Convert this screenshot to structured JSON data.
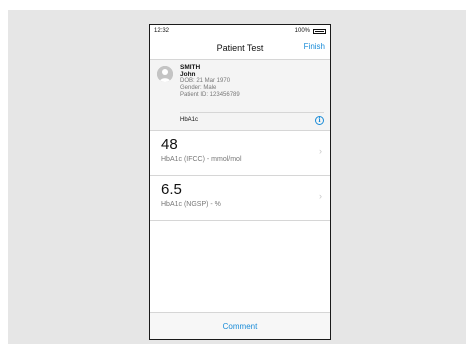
{
  "status_bar": {
    "time": "12:32",
    "battery_label": "100%",
    "battery_level": 1.0
  },
  "nav": {
    "title": "Patient Test",
    "finish_label": "Finish"
  },
  "patient": {
    "surname": "SMITH",
    "given_name": "John",
    "dob": "DOB: 21 Mar 1970",
    "gender": "Gender: Male",
    "patient_id": "Patient ID: 123456789",
    "test_name": "HbA1c",
    "info_icon": "i"
  },
  "results": [
    {
      "value": "48",
      "label": "HbA1c (IFCC) - mmol/mol",
      "chevron": "›"
    },
    {
      "value": "6.5",
      "label": "HbA1c (NGSP) - %",
      "chevron": "›"
    }
  ],
  "toolbar": {
    "comment_label": "Comment"
  },
  "colors": {
    "accent": "#1a8cd8",
    "backdrop": "#e6e6e6",
    "card_background": "#f4f4f4"
  },
  "icons": {
    "avatar": "person-avatar-icon",
    "info": "info-icon",
    "chevron": "chevron-right-icon",
    "battery": "battery-icon"
  }
}
